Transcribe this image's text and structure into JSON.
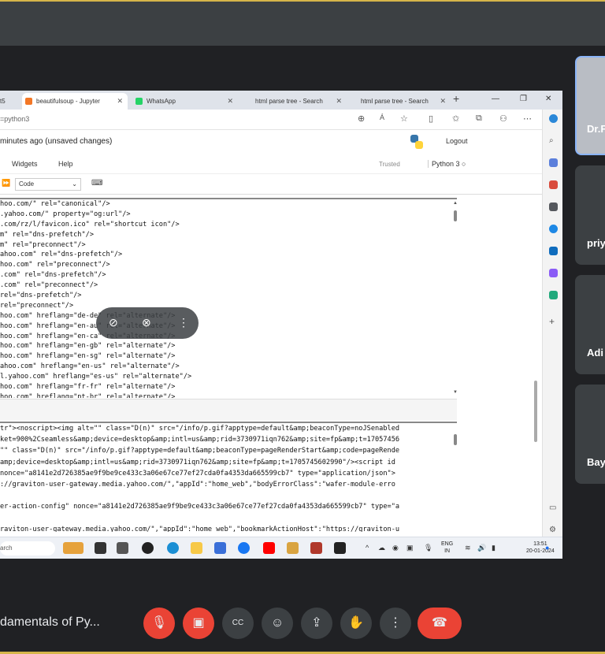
{
  "browser": {
    "tabs": [
      {
        "label": "beautifulsoup - Jupyter",
        "icon": "jupyter-icon",
        "color": "#f37726"
      },
      {
        "label": "WhatsApp",
        "icon": "whatsapp-icon",
        "color": "#25d366"
      },
      {
        "label": "html parse tree - Search",
        "icon": "bing-icon",
        "color": "#cfd8e3"
      },
      {
        "label": "html parse tree - Search",
        "icon": "bing-icon",
        "color": "#cfd8e3"
      }
    ],
    "first_tab_fragment": "t5",
    "new_tab": "+",
    "address": "=python3",
    "reader_mode": "Á"
  },
  "jupyter": {
    "save_status": "minutes ago  (unsaved changes)",
    "logout": "Logout",
    "menu": [
      "Widgets",
      "Help"
    ],
    "trusted": "Trusted",
    "kernel": "Python 3",
    "cell_type": "Code"
  },
  "output1": [
    "hoo.com/\" rel=\"canonical\"/>",
    ".yahoo.com/\" property=\"og:url\"/>",
    ".com/rz/l/favicon.ico\" rel=\"shortcut icon\"/>",
    "m\" rel=\"dns-prefetch\"/>",
    "m\" rel=\"preconnect\"/>",
    "ahoo.com\" rel=\"dns-prefetch\"/>",
    "hoo.com\" rel=\"preconnect\"/>",
    ".com\" rel=\"dns-prefetch\"/>",
    ".com\" rel=\"preconnect\"/>",
    "rel=\"dns-prefetch\"/>",
    "rel=\"preconnect\"/>",
    "hoo.com\" hreflang=\"de-de\" rel=\"alternate\"/>",
    "hoo.com\" hreflang=\"en-au\" rel=\"alternate\"/>",
    "hoo.com\" hreflang=\"en-ca\" rel=\"alternate\"/>",
    "hoo.com\" hreflang=\"en-gb\" rel=\"alternate\"/>",
    "hoo.com\" hreflang=\"en-sg\" rel=\"alternate\"/>",
    "ahoo.com\" hreflang=\"en-us\" rel=\"alternate\"/>",
    "l.yahoo.com\" hreflang=\"es-us\" rel=\"alternate\"/>",
    "hoo.com\" hreflang=\"fr-fr\" rel=\"alternate\"/>",
    "hoo.com\" hreflang=\"pt-br\" rel=\"alternate\"/>"
  ],
  "output2": [
    "tr\"><noscript><img alt=\"\" class=\"D(n)\" src=\"/info/p.gif?apptype=default&amp;beaconType=noJSenabled",
    "ket=900%2Cseamless&amp;device=desktop&amp;intl=us&amp;rid=3730971iqn762&amp;site=fp&amp;t=17057456",
    "\"\" class=\"D(n)\" src=\"/info/p.gif?apptype=default&amp;beaconType=pageRenderStart&amp;code=pageRende",
    "amp;device=desktop&amp;intl=us&amp;rid=3730971iqn762&amp;site=fp&amp;t=1705745602990\"/><script id",
    "nonce=\"a8141e2d726385ae9f9be9ce433c3a06e67ce77ef27cda0fa4353da665599cb7\" type=\"application/json\">",
    "://graviton-user-gateway.media.yahoo.com/\",\"appId\":\"home_web\",\"bodyErrorClass\":\"wafer-module-erro",
    "",
    "er-action-config\" nonce=\"a8141e2d726385ae9f9be9ce433c3a06e67ce77ef27cda0fa4353da665599cb7\" type=\"a",
    "",
    "raviton-user-gateway.media.yahoo.com/\",\"appId\":\"home_web\",\"bookmarkActionHost\":\"https://graviton-u"
  ],
  "taskbar": {
    "search": "arch",
    "lang_top": "ENG",
    "lang_bottom": "IN",
    "time": "13:51",
    "date": "20-01-2024"
  },
  "participants": [
    {
      "name": "Dr.F"
    },
    {
      "name": "priy"
    },
    {
      "name": "Adi"
    },
    {
      "name": "Bay"
    }
  ],
  "meeting": {
    "title": "damentals of Py..."
  },
  "colors": {
    "accent_border": "#d6b54a",
    "end_call": "#ea4335"
  }
}
